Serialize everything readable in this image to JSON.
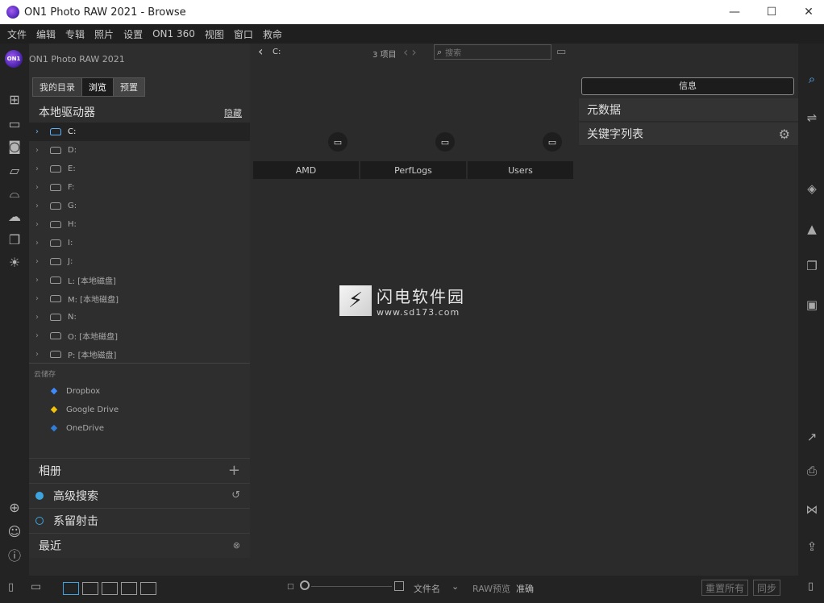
{
  "window": {
    "title": "ON1 Photo RAW 2021 - Browse",
    "minimize": "—",
    "maximize": "☐",
    "close": "✕"
  },
  "menu": [
    "文件",
    "编辑",
    "专辑",
    "照片",
    "设置",
    "ON1 360",
    "视图",
    "窗口",
    "救命"
  ],
  "app": {
    "logo_text": "ON1",
    "name": "ON1 Photo RAW 2021"
  },
  "left_panel": {
    "tabs": [
      "我的目录",
      "浏览",
      "预置"
    ],
    "active_tab": "浏览",
    "local_drives_title": "本地驱动器",
    "hide_label": "隐藏",
    "drives": [
      "C:",
      "D:",
      "E:",
      "F:",
      "G:",
      "H:",
      "I:",
      "J:",
      "L: [本地磁盘]",
      "M: [本地磁盘]",
      "N:",
      "O: [本地磁盘]",
      "P: [本地磁盘]"
    ],
    "selected_drive": "C:",
    "cloud_label": "云储存",
    "cloud": [
      {
        "name": "Dropbox",
        "color": "#3d8bff",
        "icon": "dropbox-icon"
      },
      {
        "name": "Google Drive",
        "color": "#f4c20d",
        "icon": "google-drive-icon"
      },
      {
        "name": "OneDrive",
        "color": "#2f7fd8",
        "icon": "onedrive-icon"
      }
    ],
    "albums_label": "相册",
    "advanced_search_label": "高级搜索",
    "tethered_label": "系留射击",
    "recent_label": "最近"
  },
  "browser": {
    "path": "C:",
    "item_count": "3 项目",
    "search_placeholder": "搜索",
    "folders": [
      "AMD",
      "PerfLogs",
      "Users"
    ]
  },
  "watermark": {
    "name": "闪电软件园",
    "url": "www.sd173.com"
  },
  "right_panel": {
    "info_button": "信息",
    "metadata_label": "元数据",
    "keyword_list_label": "关键字列表"
  },
  "bottom": {
    "sort_label": "文件名",
    "raw_preview_label": "RAW预览",
    "accuracy_label": "准确",
    "reset_all": "重置所有",
    "sync": "同步"
  },
  "colors": {
    "accent": "#5fb3ff",
    "search_dot": "#3ea4e0",
    "tether_dot": "#3ea4e0"
  }
}
